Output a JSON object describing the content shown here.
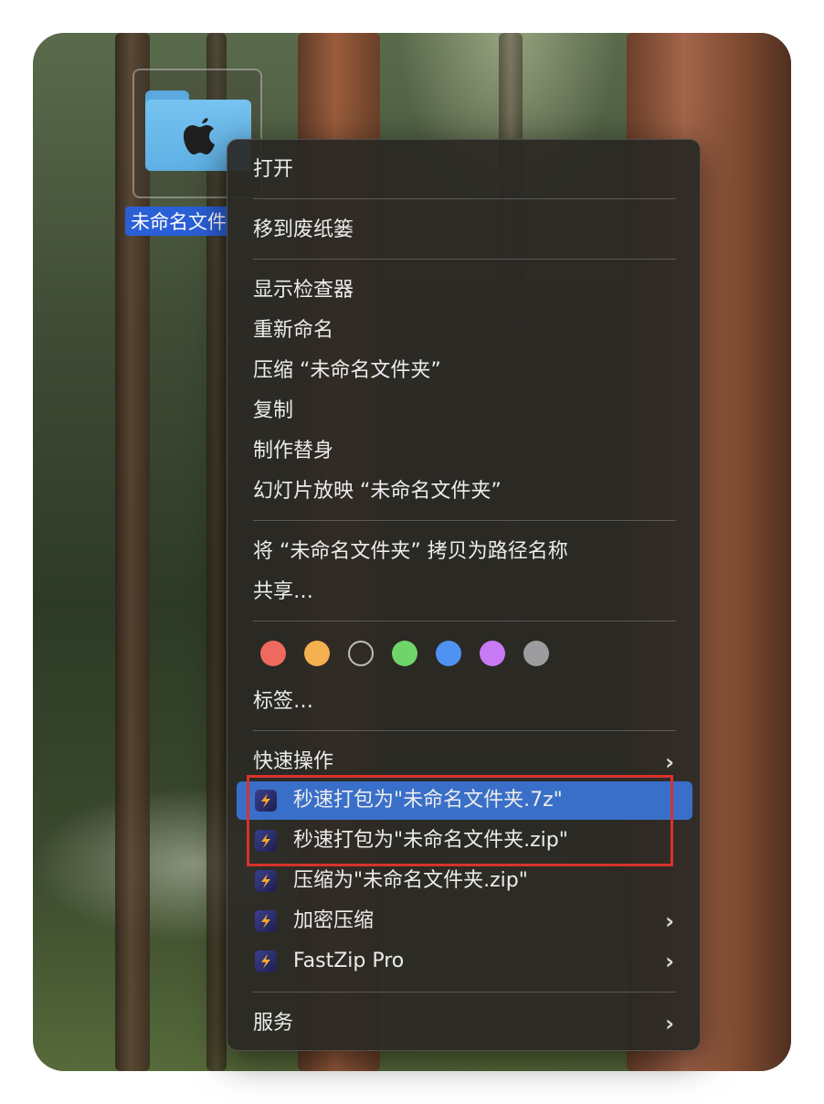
{
  "desktop": {
    "folder": {
      "name": "未命名文件"
    }
  },
  "menu": {
    "open": "打开",
    "trash": "移到废纸篓",
    "get_info": "显示检查器",
    "rename": "重新命名",
    "compress": "压缩 “未命名文件夹”",
    "duplicate": "复制",
    "make_alias": "制作替身",
    "slideshow": "幻灯片放映 “未命名文件夹”",
    "copy_path": "将 “未命名文件夹” 拷贝为路径名称",
    "share": "共享…",
    "tag_colors": [
      "#ee6a5e",
      "#f5b04f",
      "transparent",
      "#6fd56a",
      "#4f93f2",
      "#c77af4",
      "#9d9d9f"
    ],
    "tags": "标签…",
    "quick_actions": "快速操作",
    "quick_items": [
      "秒速打包为\"未命名文件夹.7z\"",
      "秒速打包为\"未命名文件夹.zip\"",
      "压缩为\"未命名文件夹.zip\"",
      "加密压缩",
      "FastZip Pro"
    ],
    "services": "服务",
    "chevron": "›"
  }
}
